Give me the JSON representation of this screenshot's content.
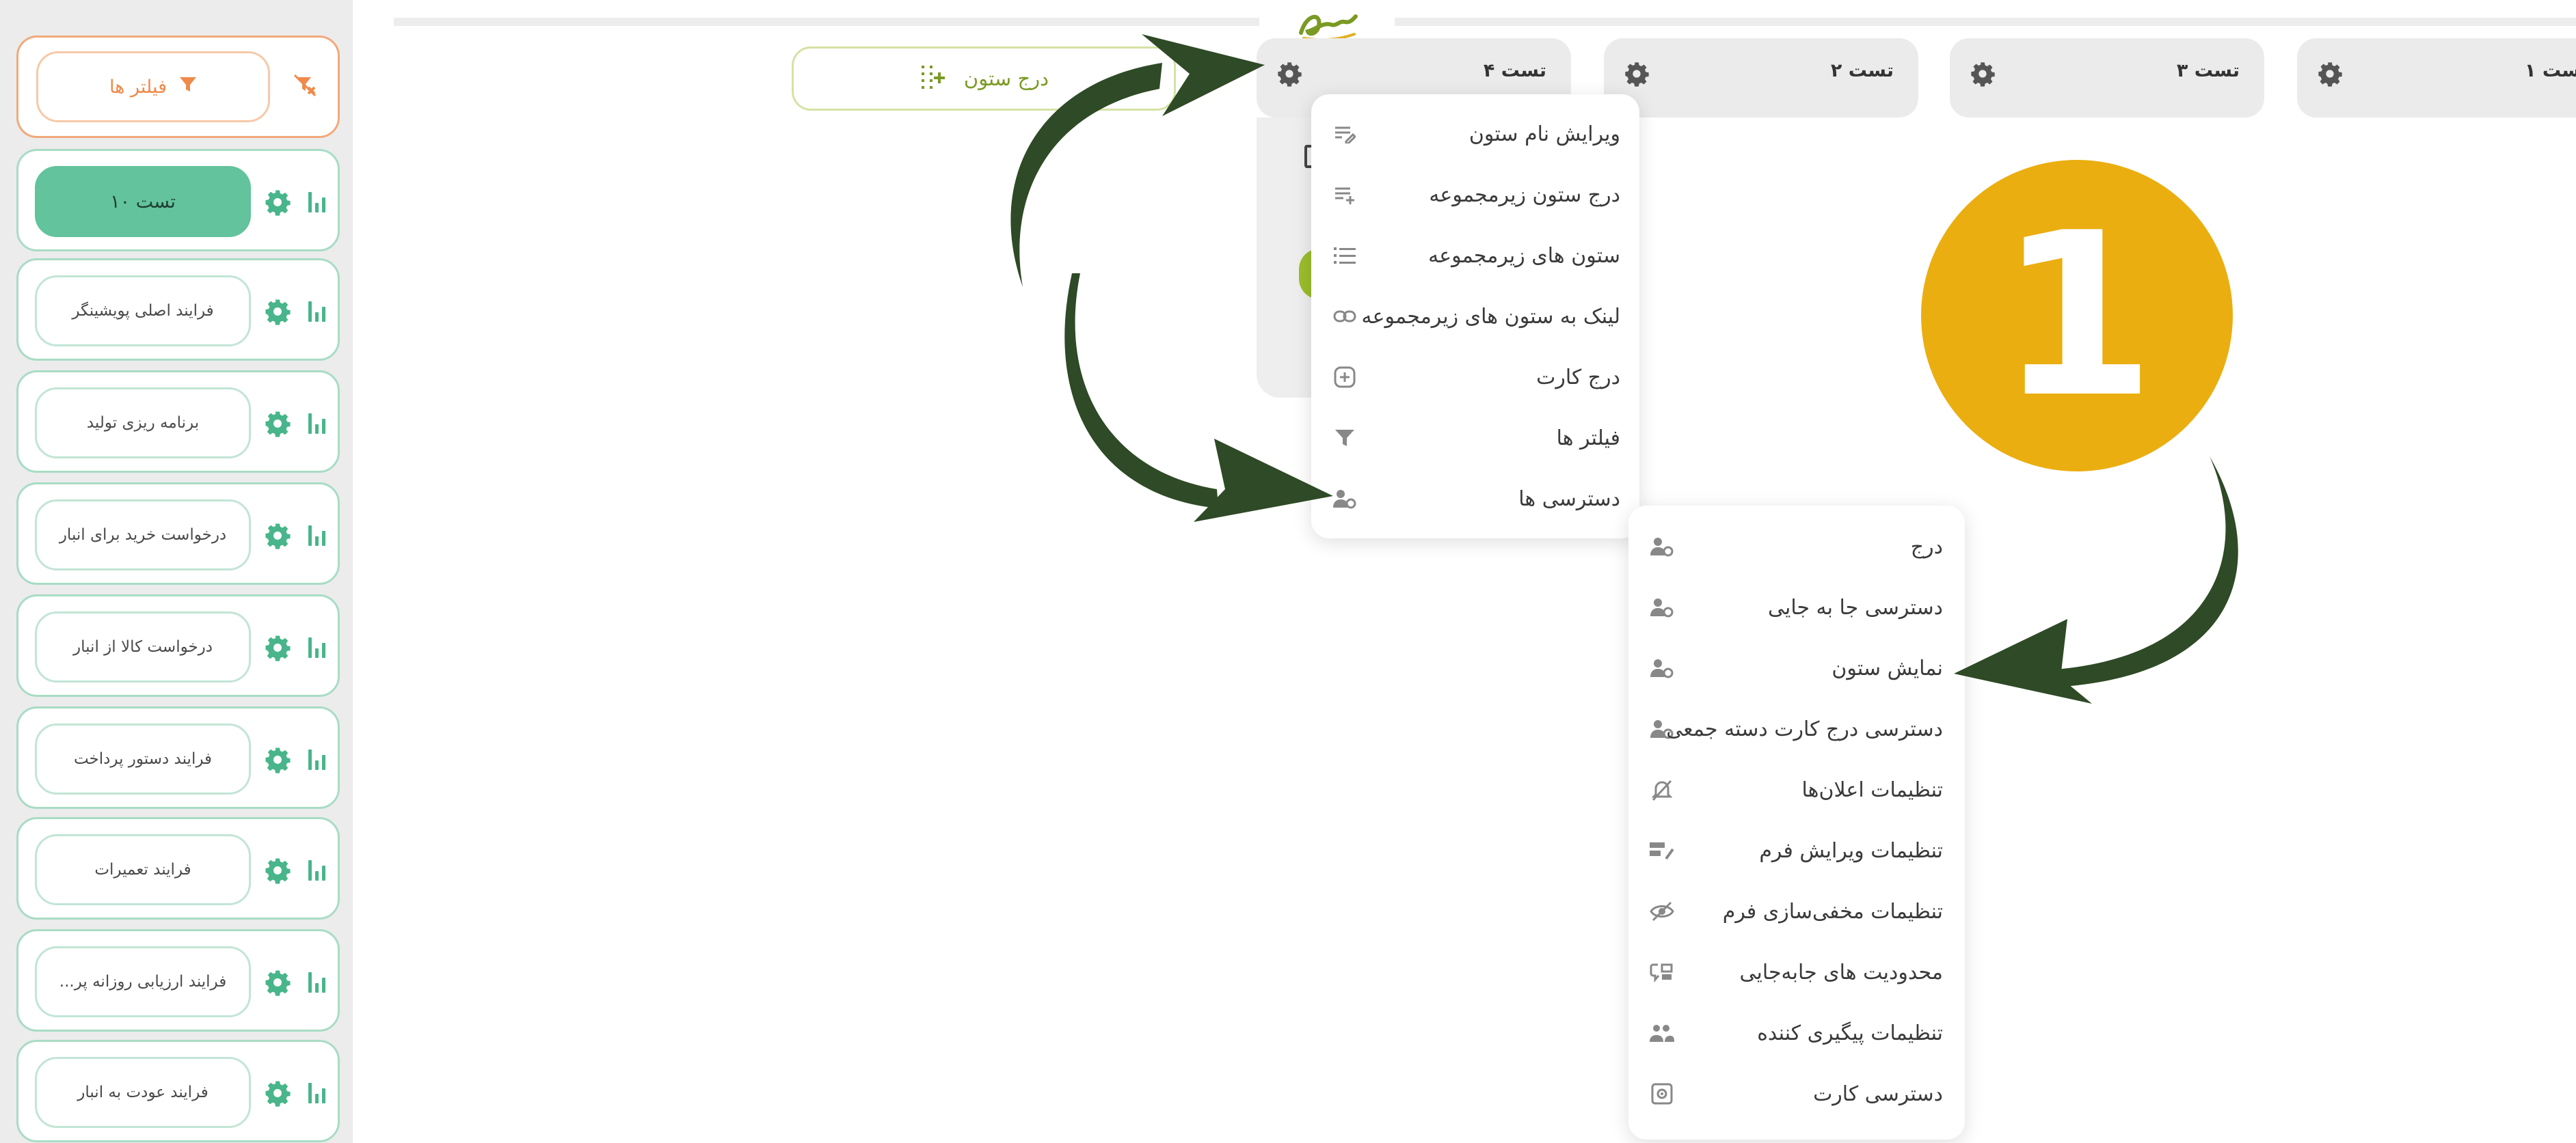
{
  "sidebar": {
    "filter_label": "فیلتر ها",
    "items": [
      {
        "label": "تست ۱۰",
        "active": true
      },
      {
        "label": "فرایند اصلی پویشینگر",
        "active": false
      },
      {
        "label": "برنامه ریزی تولید",
        "active": false
      },
      {
        "label": "درخواست خرید برای انبار",
        "active": false
      },
      {
        "label": "درخواست کالا از انبار",
        "active": false
      },
      {
        "label": "فرایند دستور پرداخت",
        "active": false
      },
      {
        "label": "فرایند تعمیرات",
        "active": false
      },
      {
        "label": "فرایند ارزیابی روزانه پر...",
        "active": false
      },
      {
        "label": "فرایند عودت به انبار",
        "active": false
      }
    ]
  },
  "toolbar": {
    "add_column_label": "درج ستون"
  },
  "columns": [
    {
      "title": "تست ۴"
    },
    {
      "title": "تست ۲"
    },
    {
      "title": "تست ۳"
    },
    {
      "title": "ست ۱"
    }
  ],
  "column_menu": {
    "items": [
      {
        "label": "ویرایش نام ستون",
        "icon": "edit-text-icon"
      },
      {
        "label": "درج ستون زیرمجموعه",
        "icon": "add-list-icon"
      },
      {
        "label": "ستون های زیرمجموعه",
        "icon": "list-icon"
      },
      {
        "label": "لینک به ستون های زیرمجموعه",
        "icon": "link-icon"
      },
      {
        "label": "درج کارت",
        "icon": "plus-box-icon"
      },
      {
        "label": "فیلتر ها",
        "icon": "filter-icon"
      },
      {
        "label": "دسترسی ها",
        "icon": "user-gear-icon"
      }
    ]
  },
  "access_menu": {
    "items": [
      {
        "label": "درج",
        "icon": "user-gear-icon"
      },
      {
        "label": "دسترسی جا به جایی",
        "icon": "user-gear-icon"
      },
      {
        "label": "نمایش ستون",
        "icon": "user-gear-icon"
      },
      {
        "label": "دسترسی درج کارت دسته جمعی",
        "icon": "user-gear-icon"
      },
      {
        "label": "تنظیمات اعلان‌ها",
        "icon": "bell-off-icon"
      },
      {
        "label": "تنظیمات ویرایش فرم",
        "icon": "form-edit-icon"
      },
      {
        "label": "تنظیمات مخفی‌سازی فرم",
        "icon": "eye-off-icon"
      },
      {
        "label": "محدودیت های جابه‌جایی",
        "icon": "move-limit-icon"
      },
      {
        "label": "تنظیمات پیگیری کننده",
        "icon": "users-icon"
      },
      {
        "label": "دسترسی کارت",
        "icon": "card-access-icon"
      }
    ]
  },
  "callout": {
    "number": "1"
  },
  "colors": {
    "arrow": "#2e4a26",
    "callout": "#ebae10",
    "accent_green": "#62c39d",
    "accent_orange": "#ef8a4a",
    "add_column_green": "#7a9a23"
  }
}
